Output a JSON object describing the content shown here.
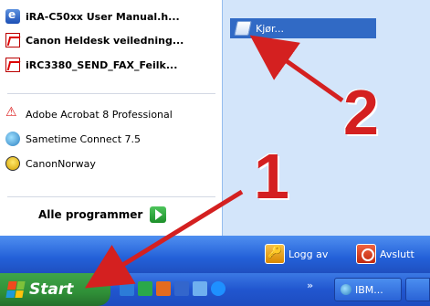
{
  "start_menu": {
    "pinned": [
      {
        "label": "iRA-C50xx User Manual.h...",
        "icon": "web-document-icon"
      },
      {
        "label": "Canon Heldesk veiledning...",
        "icon": "pdf-icon"
      },
      {
        "label": "iRC3380_SEND_FAX_Feilk...",
        "icon": "pdf-icon"
      }
    ],
    "recent": [
      {
        "label": "Adobe Acrobat 8 Professional",
        "icon": "acrobat-icon"
      },
      {
        "label": "Sametime Connect 7.5",
        "icon": "sametime-icon"
      },
      {
        "label": "CanonNorway",
        "icon": "canon-icon"
      }
    ],
    "all_programs": "Alle programmer",
    "right": {
      "run": "Kjør..."
    },
    "logoff": "Logg av",
    "shutdown": "Avslutt"
  },
  "taskbar": {
    "start": "Start",
    "chevron": "»",
    "tasks": [
      {
        "label": "IBM..."
      }
    ]
  },
  "annotations": {
    "one": "1",
    "two": "2",
    "color": "#d42020"
  }
}
